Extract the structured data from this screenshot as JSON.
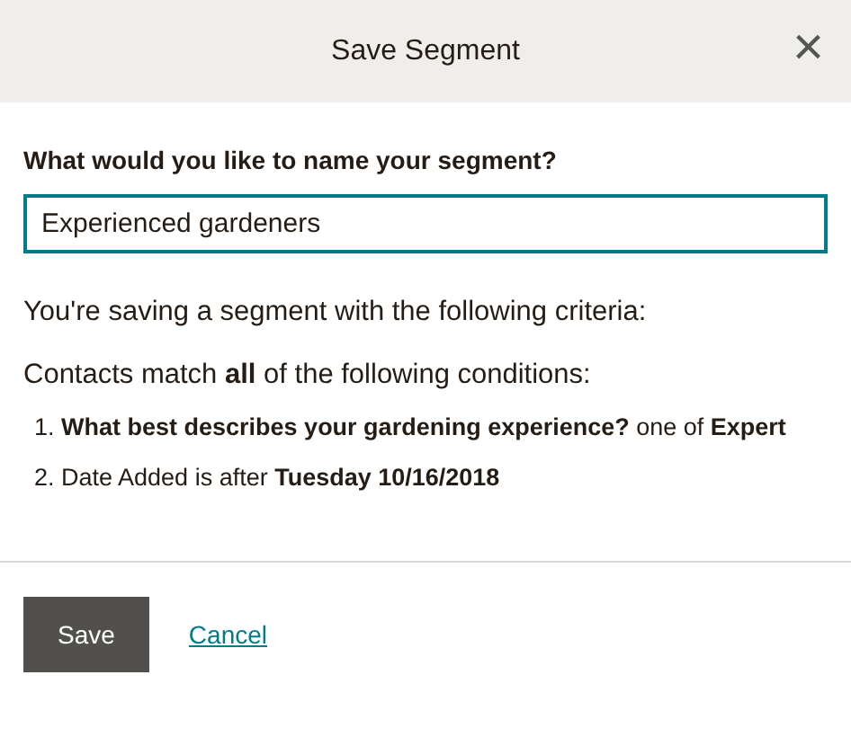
{
  "dialog": {
    "title": "Save Segment",
    "close": "×"
  },
  "name_field": {
    "label": "What would you like to name your segment?",
    "value": "Experienced gardeners",
    "focused": true
  },
  "summary": "You're saving a segment with the following criteria:",
  "match": "Contacts match **all** of the following conditions:",
  "conditions": [
    {
      "text": "1. **What best describes your gardening experience?** one of **Expert**"
    },
    {
      "text": "2. Date Added is after **Tuesday 10/16/2018**"
    }
  ],
  "buttons": [
    {
      "kind": "primary",
      "label": "Save"
    },
    {
      "kind": "link",
      "label": "Cancel"
    }
  ]
}
